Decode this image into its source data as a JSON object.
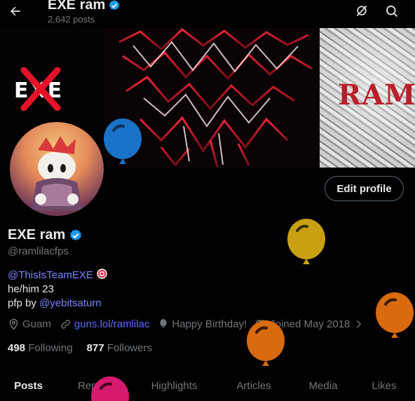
{
  "header": {
    "display_name": "EXE ram",
    "post_count": "2,642 posts"
  },
  "banner": {
    "left_mark": "EXE",
    "right_text": "RAM."
  },
  "profile": {
    "display_name": "EXE ram",
    "handle": "@ramlilacfps",
    "edit_button": "Edit profile",
    "bio": {
      "team_mention": "@ThisIsTeamEXE",
      "line2": "he/him 23",
      "pfp_prefix": "pfp by ",
      "pfp_mention": "@yebitsaturn"
    },
    "meta": {
      "location": "Guam",
      "website": "guns.lol/ramlilac",
      "birthday": "Happy Birthday!",
      "joined": "Joined May 2018"
    },
    "following_count": "498",
    "following_label": "Following",
    "followers_count": "877",
    "followers_label": "Followers"
  },
  "tabs": [
    {
      "label": "Posts",
      "active": true
    },
    {
      "label": "Replies",
      "active": false
    },
    {
      "label": "Highlights",
      "active": false
    },
    {
      "label": "Articles",
      "active": false
    },
    {
      "label": "Media",
      "active": false
    },
    {
      "label": "Likes",
      "active": false
    }
  ],
  "colors": {
    "accent_blue": "#1d9bf0",
    "verified": "#1d9bf0",
    "muted": "#71767b",
    "balloon_blue": "#1a73c9",
    "balloon_gold": "#c9a012",
    "balloon_orange": "#d96a0e",
    "balloon_pink": "#d61a6e"
  },
  "icons": [
    "back-arrow-icon",
    "hide-balloons-icon",
    "search-icon",
    "verified-badge-icon",
    "location-icon",
    "link-icon",
    "balloon-icon",
    "calendar-icon",
    "chevron-right-icon"
  ]
}
